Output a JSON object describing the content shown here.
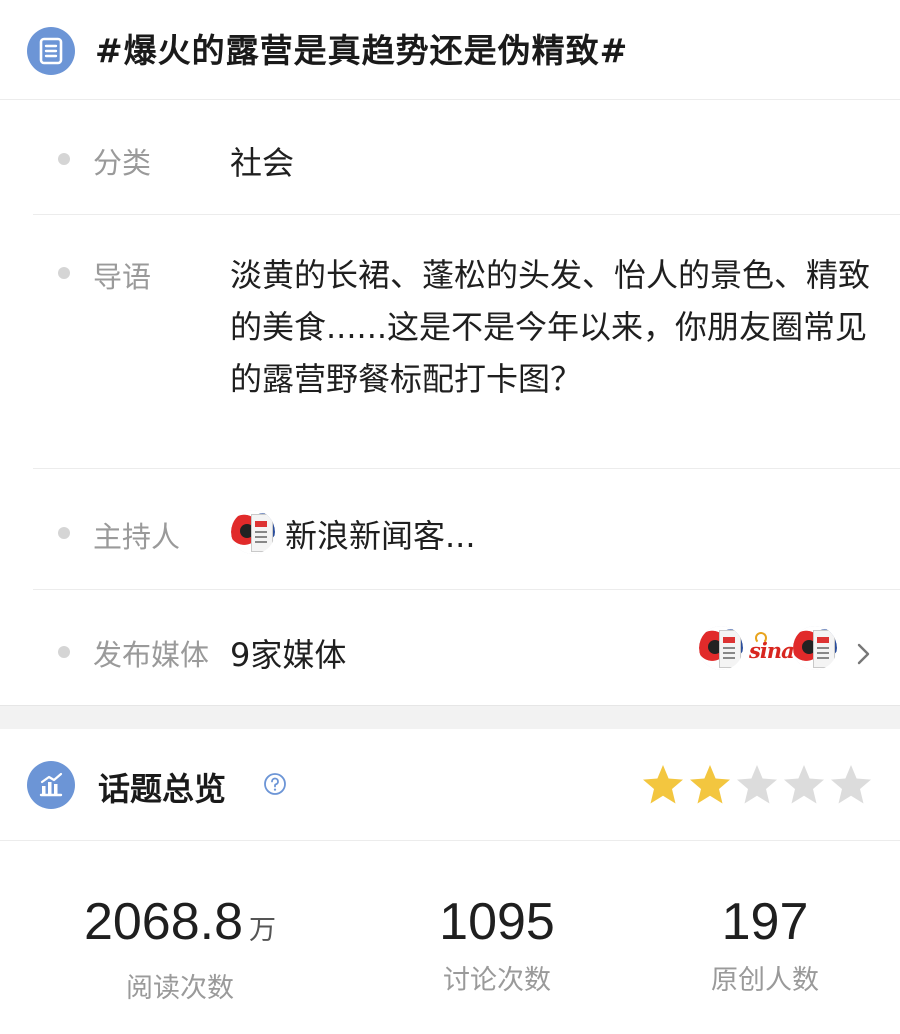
{
  "header": {
    "icon": "list-document-icon",
    "title": "#爆火的露营是真趋势还是伪精致#"
  },
  "info": {
    "category": {
      "label": "分类",
      "value": "社会"
    },
    "lead": {
      "label": "导语",
      "value": "淡黄的长裙、蓬松的头发、怡人的景色、精致的美食......这是不是今年以来，你朋友圈常见的露营野餐标配打卡图？"
    },
    "host": {
      "label": "主持人",
      "value": "新浪新闻客...",
      "avatar": "sina-news-avatar-icon"
    },
    "media": {
      "label": "发布媒体",
      "value": "9家媒体",
      "logo_text": "sina"
    }
  },
  "overview": {
    "icon": "bar-chart-icon",
    "title": "话题总览",
    "rating": {
      "filled": 2,
      "total": 5
    },
    "colors": {
      "star_filled": "#f3c63f",
      "star_empty": "#dcdcdc",
      "accent": "#6c95d6"
    }
  },
  "stats": [
    {
      "value": "2068.8",
      "unit": "万",
      "label": "阅读次数"
    },
    {
      "value": "1095",
      "unit": "",
      "label": "讨论次数"
    },
    {
      "value": "197",
      "unit": "",
      "label": "原创人数"
    }
  ]
}
